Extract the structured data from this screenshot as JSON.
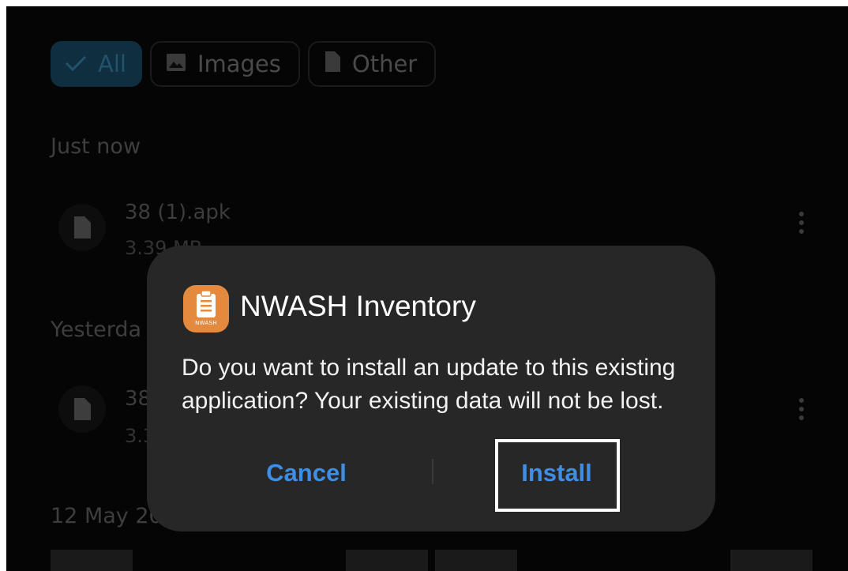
{
  "filters": [
    {
      "label": "All",
      "icon": "check-icon",
      "active": true
    },
    {
      "label": "Images",
      "icon": "image-icon",
      "active": false
    },
    {
      "label": "Other",
      "icon": "file-icon",
      "active": false
    }
  ],
  "sections": {
    "just_now": "Just now",
    "yesterday": "Yesterda",
    "older": "12 May 20"
  },
  "files": [
    {
      "name": "38 (1).apk",
      "meta": "3.39 MB"
    },
    {
      "name": "38",
      "meta": "3.3"
    }
  ],
  "dialog": {
    "app_name": "NWASH Inventory",
    "icon_text": "NWASH",
    "message": "Do you want to install an update to this existing application? Your existing data will not be lost.",
    "cancel_label": "Cancel",
    "install_label": "Install"
  },
  "colors": {
    "accent": "#3f8ee6",
    "app_icon": "#e48a3e",
    "dialog_bg": "#272727",
    "highlight": "#ffffff"
  }
}
